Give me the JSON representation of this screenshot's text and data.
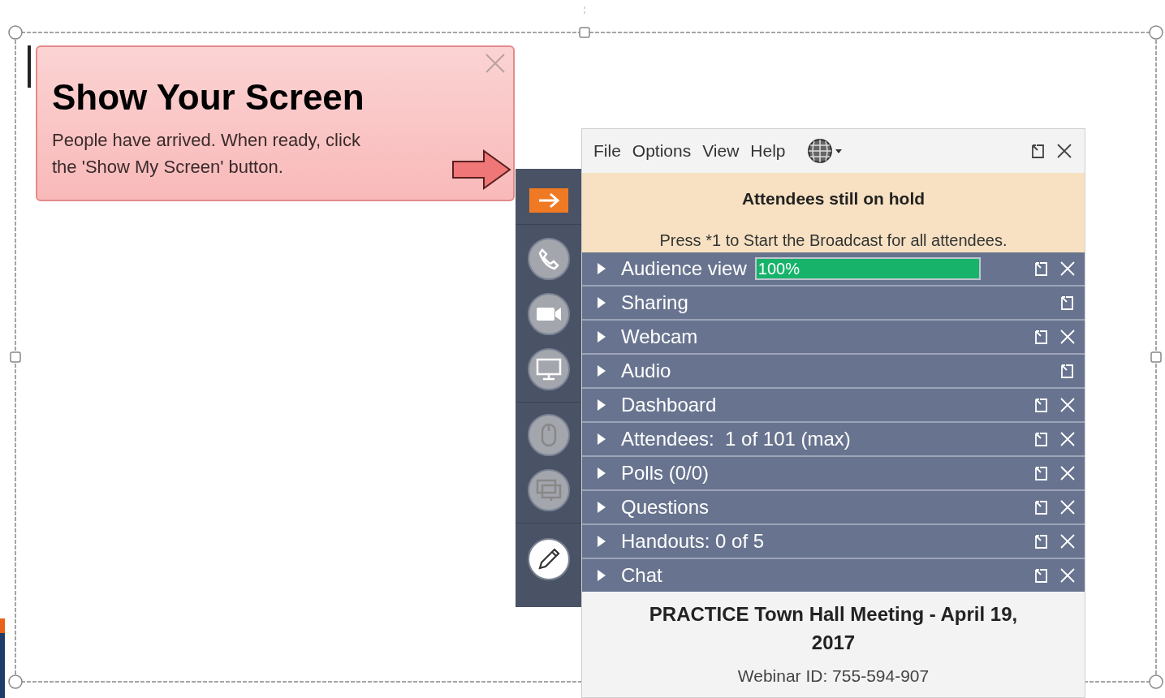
{
  "callout": {
    "title": "Show Your Screen",
    "message": "People have arrived. When ready, click the 'Show My Screen' button."
  },
  "menu": [
    "File",
    "Options",
    "View",
    "Help"
  ],
  "banner": {
    "title": "Attendees still on hold",
    "message": "Press *1 to Start the Broadcast for all attendees."
  },
  "panes": [
    {
      "label": "Audience view",
      "kind": "meter",
      "level": 1,
      "reading": "100%",
      "closable": true
    },
    {
      "label": "Sharing",
      "kind": "plain",
      "closable": false
    },
    {
      "label": "Webcam",
      "kind": "plain",
      "closable": true
    },
    {
      "label": "Audio",
      "kind": "plain",
      "closable": false
    },
    {
      "label": "Dashboard",
      "kind": "plain",
      "closable": true
    },
    {
      "label": "Attendees:  1 of 101 (max)",
      "kind": "plain",
      "closable": true
    },
    {
      "label": "Polls (0/0)",
      "kind": "plain",
      "closable": true
    },
    {
      "label": "Questions",
      "kind": "plain",
      "closable": true
    },
    {
      "label": "Handouts: 0 of 5",
      "kind": "plain",
      "closable": true
    },
    {
      "label": "Chat",
      "kind": "plain",
      "closable": true
    }
  ],
  "footer": {
    "title": "PRACTICE Town Hall Meeting - April 19, 2017",
    "webinar_id": "Webinar ID: 755-594-907"
  }
}
